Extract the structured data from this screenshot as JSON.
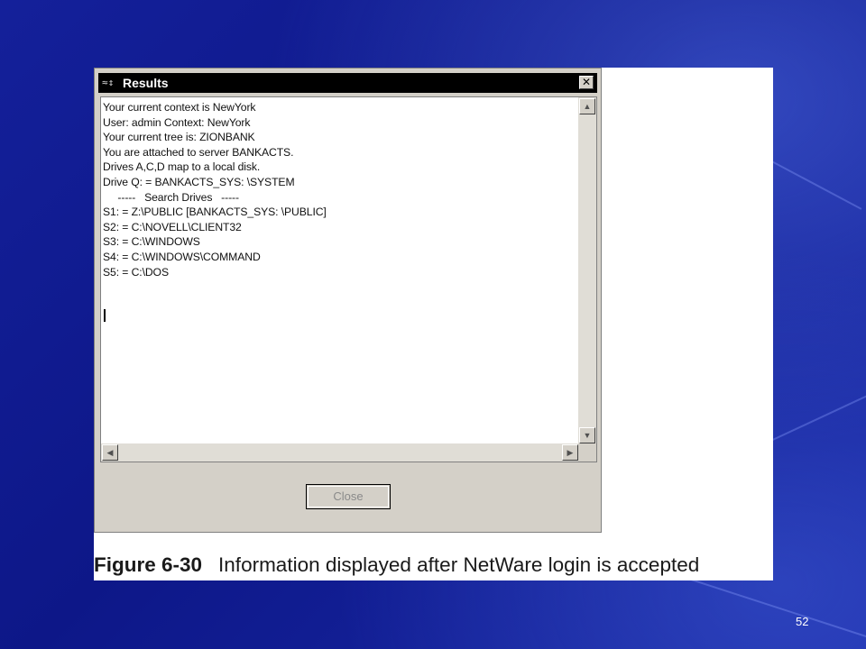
{
  "window": {
    "title": "Results",
    "close_label": "Close",
    "lines": [
      "Your current context is NewYork",
      "User: admin Context: NewYork",
      "Your current tree is: ZIONBANK",
      "You are attached to server BANKACTS.",
      "Drives A,C,D map to a local disk.",
      "Drive Q: = BANKACTS_SYS: \\SYSTEM",
      "     -----   Search Drives   -----",
      "S1: = Z:\\PUBLIC [BANKACTS_SYS: \\PUBLIC]",
      "S2: = C:\\NOVELL\\CLIENT32",
      "S3: = C:\\WINDOWS",
      "S4: = C:\\WINDOWS\\COMMAND",
      "S5: = C:\\DOS"
    ]
  },
  "caption": {
    "figure": "Figure 6-30",
    "text": "Information displayed after NetWare login is accepted"
  },
  "slide": {
    "page_number": "52"
  },
  "icons": {
    "app": "netware-app-icon",
    "close": "close-icon",
    "scroll_up": "arrow-up-icon",
    "scroll_down": "arrow-down-icon",
    "scroll_left": "arrow-left-icon",
    "scroll_right": "arrow-right-icon"
  }
}
